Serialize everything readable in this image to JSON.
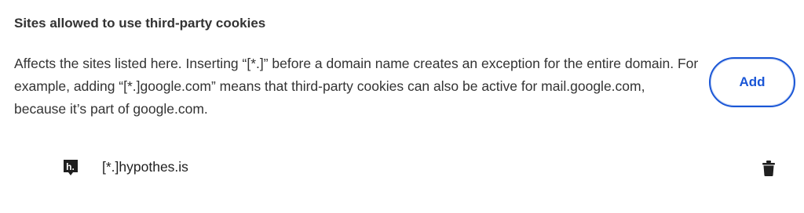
{
  "section": {
    "title": "Sites allowed to use third-party cookies",
    "description": "Affects the sites listed here. Inserting “[*.]” before a domain name creates an exception for the entire domain. For example, adding “[*.]google.com” means that third-party cookies can also be active for mail.google.com, because it’s part of google.com.",
    "add_label": "Add"
  },
  "sites": [
    {
      "name": "[*.]hypothes.is",
      "favicon": "hypothesis-icon",
      "favicon_text": "h.",
      "action_icon": "trash-icon"
    }
  ],
  "colors": {
    "accent": "#1a56d6",
    "text": "#1f1f1f",
    "secondary_text": "#333333",
    "icon": "#1f1f1f"
  }
}
